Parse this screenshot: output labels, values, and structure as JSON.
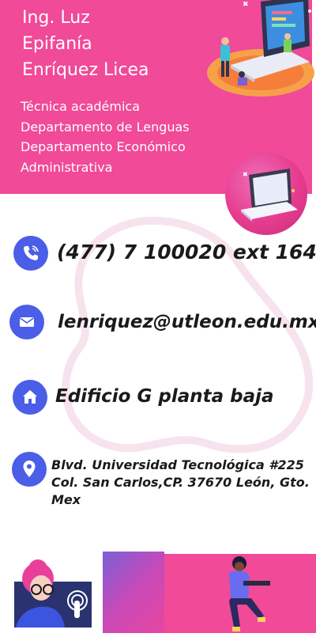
{
  "profile": {
    "name_lines": [
      "Ing. Luz",
      "Epifanía",
      "Enríquez Licea"
    ],
    "role_lines": [
      "Técnica académica",
      "Departamento de Lenguas",
      "Departamento Económico",
      "Administrativa"
    ]
  },
  "contact": {
    "phone": "(477) 7 100020 ext 164",
    "email": "lenriquez@utleon.edu.mx",
    "building": "Edificio G planta baja",
    "address_lines": [
      "Blvd. Universidad Tecnológica #225",
      "Col. San Carlos,CP. 37670 León, Gto.",
      "Mex"
    ]
  },
  "colors": {
    "header_pink": "#f04a98",
    "icon_blue": "#4a5ee8",
    "text_dark": "#1a1a1a"
  },
  "icons": {
    "phone": "phone-icon",
    "email": "envelope-icon",
    "building": "home-icon",
    "address": "location-pin-icon"
  }
}
